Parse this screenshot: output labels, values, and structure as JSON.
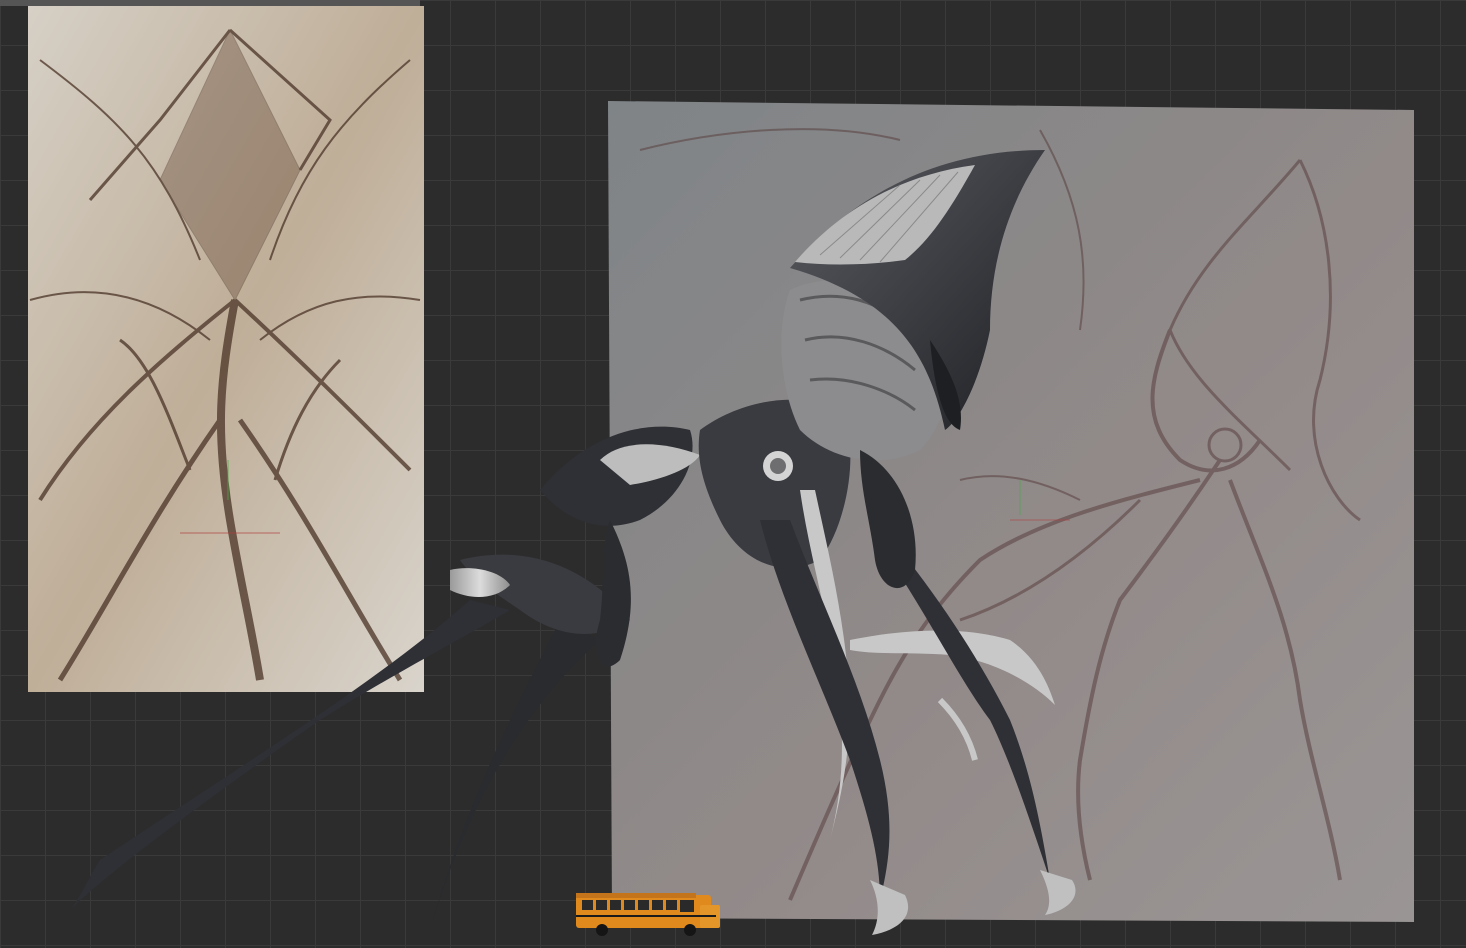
{
  "viewport": {
    "background_color": "#2c2c2c",
    "grid_color": "#3a3a3a"
  },
  "reference_left": {
    "tint": "#c9b9a8",
    "ink": "#4a3326"
  },
  "reference_right": {
    "tint": "#8d8e90",
    "ink": "#5a4040"
  },
  "model": {
    "body_color": "#2f3035",
    "bone_color": "#c8c8c8"
  },
  "scale_reference": {
    "color": "#e08a1e"
  }
}
